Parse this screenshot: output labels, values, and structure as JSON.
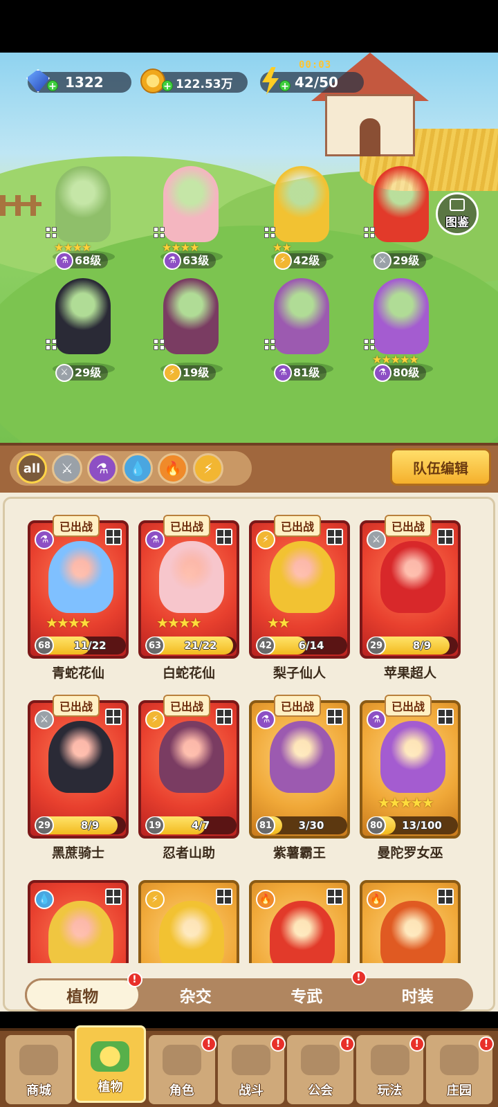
{
  "resources": {
    "gems": "1322",
    "coins": "122.53万",
    "energy": "42/50",
    "energy_timer": "00:03"
  },
  "codex_label": "图鉴",
  "team": [
    {
      "stars": "★★★★",
      "level": "68级",
      "element": "potion",
      "color": "#8fbf6a"
    },
    {
      "stars": "★★★★",
      "level": "63级",
      "element": "potion",
      "color": "#f4b6c0"
    },
    {
      "stars": "★★",
      "level": "42级",
      "element": "bolt",
      "color": "#f2c232"
    },
    {
      "stars": "",
      "level": "29级",
      "element": "sword",
      "color": "#e23a2a"
    },
    {
      "stars": "",
      "level": "29级",
      "element": "sword",
      "color": "#2a2a36"
    },
    {
      "stars": "",
      "level": "19级",
      "element": "bolt",
      "color": "#7a3c62"
    },
    {
      "stars": "",
      "level": "81级",
      "element": "potion",
      "color": "#9c5ab0"
    },
    {
      "stars": "★★★★★",
      "level": "80级",
      "element": "potion",
      "color": "#a45cd0"
    }
  ],
  "filters": [
    "all",
    "sword",
    "potion",
    "water",
    "fire",
    "bolt"
  ],
  "filter_all_label": "all",
  "team_edit_label": "队伍编辑",
  "deployed_label": "已出战",
  "cards": [
    {
      "name": "青蛇花仙",
      "level": "68",
      "progress": "11/22",
      "stars": "★★★★",
      "element": "potion",
      "frame": "red",
      "color": "#7fc0ff",
      "deployed": true
    },
    {
      "name": "白蛇花仙",
      "level": "63",
      "progress": "21/22",
      "stars": "★★★★",
      "element": "potion",
      "frame": "red",
      "color": "#f7c6cc",
      "deployed": true
    },
    {
      "name": "梨子仙人",
      "level": "42",
      "progress": "6/14",
      "stars": "★★",
      "element": "bolt",
      "frame": "red",
      "color": "#f2c232",
      "deployed": true
    },
    {
      "name": "苹果超人",
      "level": "29",
      "progress": "8/9",
      "stars": "",
      "element": "sword",
      "frame": "red",
      "color": "#d8282a",
      "deployed": true
    },
    {
      "name": "黑蔗骑士",
      "level": "29",
      "progress": "8/9",
      "stars": "",
      "element": "sword",
      "frame": "red",
      "color": "#2a2a36",
      "deployed": true
    },
    {
      "name": "忍者山助",
      "level": "19",
      "progress": "4/7",
      "stars": "",
      "element": "bolt",
      "frame": "red",
      "color": "#7a3c62",
      "deployed": true
    },
    {
      "name": "紫薯霸王",
      "level": "81",
      "progress": "3/30",
      "stars": "",
      "element": "potion",
      "frame": "gold",
      "color": "#9c5ab0",
      "deployed": true
    },
    {
      "name": "曼陀罗女巫",
      "level": "80",
      "progress": "13/100",
      "stars": "★★★★★",
      "element": "potion",
      "frame": "gold",
      "color": "#a45cd0",
      "deployed": true
    },
    {
      "name": "",
      "level": "",
      "progress": "",
      "stars": "",
      "element": "water",
      "frame": "red",
      "color": "#f0c640",
      "deployed": false
    },
    {
      "name": "",
      "level": "",
      "progress": "",
      "stars": "",
      "element": "bolt",
      "frame": "gold",
      "color": "#f2c232",
      "deployed": false
    },
    {
      "name": "",
      "level": "",
      "progress": "",
      "stars": "",
      "element": "fire",
      "frame": "gold",
      "color": "#e23a2a",
      "deployed": false
    },
    {
      "name": "",
      "level": "",
      "progress": "",
      "stars": "",
      "element": "fire",
      "frame": "gold",
      "color": "#e05a22",
      "deployed": false
    }
  ],
  "subtabs": [
    {
      "label": "植物",
      "active": true,
      "alert": true
    },
    {
      "label": "杂交",
      "active": false,
      "alert": false
    },
    {
      "label": "专武",
      "active": false,
      "alert": true
    },
    {
      "label": "时装",
      "active": false,
      "alert": false
    }
  ],
  "nav": [
    {
      "label": "商城",
      "active": false,
      "alert": false
    },
    {
      "label": "植物",
      "active": true,
      "alert": false
    },
    {
      "label": "角色",
      "active": false,
      "alert": true
    },
    {
      "label": "战斗",
      "active": false,
      "alert": true
    },
    {
      "label": "公会",
      "active": false,
      "alert": true
    },
    {
      "label": "玩法",
      "active": false,
      "alert": true
    },
    {
      "label": "庄园",
      "active": false,
      "alert": true
    }
  ],
  "alert_glyph": "!"
}
